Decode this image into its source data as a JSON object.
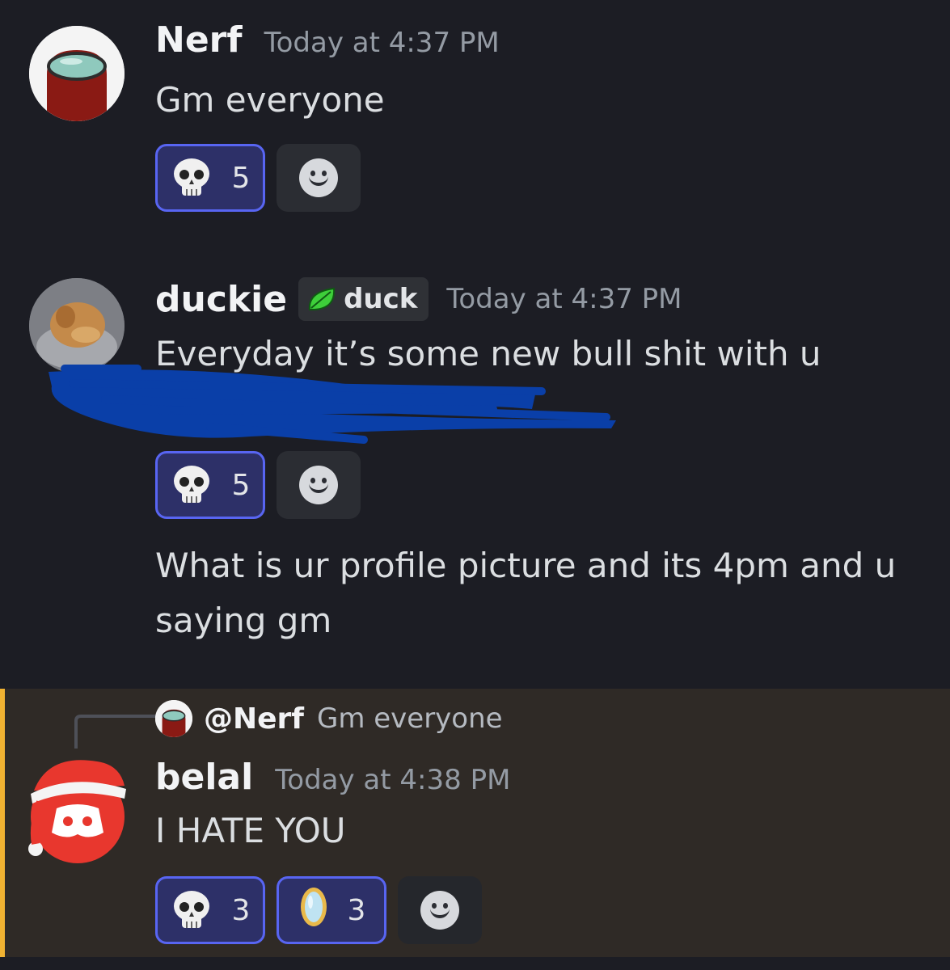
{
  "messages": [
    {
      "username": "Nerf",
      "timestamp": "Today at 4:37 PM",
      "text": "Gm everyone",
      "reactions": [
        {
          "emoji": "skull-emoji",
          "count": "5"
        }
      ],
      "add_reaction": "add-reaction-icon"
    },
    {
      "username": "duckie",
      "role_tag": "duck",
      "timestamp": "Today at 4:37 PM",
      "text": "Everyday it’s some new bull shit with u",
      "reactions": [
        {
          "emoji": "skull-emoji",
          "count": "5"
        }
      ],
      "followup_text_line1": "What is ur profile picture and its 4pm and u",
      "followup_text_line2": "saying gm"
    },
    {
      "reply_to_mention": "@Nerf",
      "reply_to_text": "Gm everyone",
      "username": "belal",
      "timestamp": "Today at 4:38 PM",
      "text": "I HATE YOU",
      "reactions": [
        {
          "emoji": "skull-emoji",
          "count": "3"
        },
        {
          "emoji": "mirror-emoji",
          "count": "3"
        }
      ]
    }
  ],
  "colors": {
    "background": "#1c1d24",
    "highlight_bg": "#2f2a26",
    "highlight_bar": "#f0b232",
    "reaction_active_bg": "#2d3068",
    "reaction_active_border": "#5865f2",
    "scribble": "#0a3fa8"
  }
}
